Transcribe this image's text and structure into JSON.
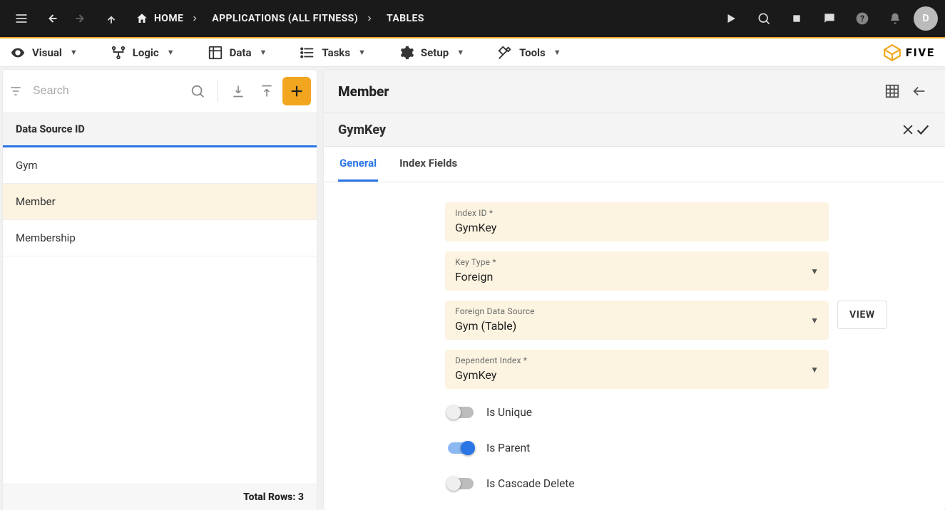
{
  "topbar": {
    "crumbs": {
      "home": "HOME",
      "app": "APPLICATIONS (ALL FITNESS)",
      "section": "TABLES"
    },
    "avatarInitial": "D"
  },
  "subbar": {
    "items": [
      "Visual",
      "Logic",
      "Data",
      "Tasks",
      "Setup",
      "Tools"
    ],
    "brand": "FIVE"
  },
  "leftpane": {
    "searchPlaceholder": "Search",
    "listHeader": "Data Source ID",
    "rows": [
      "Gym",
      "Member",
      "Membership"
    ],
    "footerLabel": "Total Rows: 3"
  },
  "rightpane": {
    "title": "Member",
    "subtitle": "GymKey",
    "tabs": {
      "general": "General",
      "indexFields": "Index Fields"
    },
    "form": {
      "indexId": {
        "label": "Index ID *",
        "value": "GymKey"
      },
      "keyType": {
        "label": "Key Type *",
        "value": "Foreign"
      },
      "foreignDs": {
        "label": "Foreign Data Source",
        "value": "Gym (Table)"
      },
      "dependentIndex": {
        "label": "Dependent Index *",
        "value": "GymKey"
      },
      "viewBtn": "VIEW",
      "switches": {
        "isUnique": "Is Unique",
        "isParent": "Is Parent",
        "isCascade": "Is Cascade Delete"
      }
    }
  }
}
